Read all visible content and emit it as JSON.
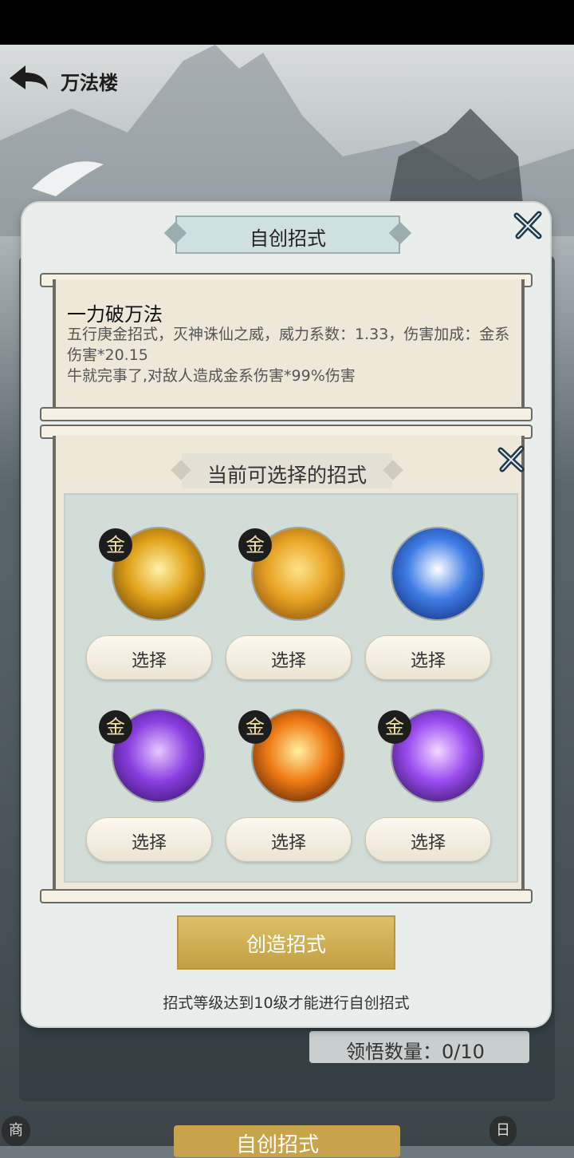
{
  "header": {
    "title": "万法楼"
  },
  "dialog": {
    "title": "自创招式",
    "current_skill": {
      "name": "一力破万法",
      "description": "五行庚金招式，灭神诛仙之威，威力系数：1.33，伤害加成：金系伤害*20.15\n牛就完事了,对敌人造成金系伤害*99%伤害"
    },
    "selection_title": "当前可选择的招式",
    "skills": [
      {
        "badge": "金",
        "select_label": "选择",
        "colors": [
          "#fff3a8",
          "#e0a21a",
          "#5a3104"
        ]
      },
      {
        "badge": "金",
        "select_label": "选择",
        "colors": [
          "#ffe38a",
          "#e8a425",
          "#7a3e08"
        ]
      },
      {
        "badge": "",
        "select_label": "选择",
        "colors": [
          "#ffffff",
          "#3f7de6",
          "#0a1d66"
        ]
      },
      {
        "badge": "金",
        "select_label": "选择",
        "colors": [
          "#e7c8ff",
          "#8a3fe0",
          "#2a0a5a"
        ]
      },
      {
        "badge": "金",
        "select_label": "选择",
        "colors": [
          "#fff0a0",
          "#ef7a14",
          "#3a1205"
        ]
      },
      {
        "badge": "金",
        "select_label": "选择",
        "colors": [
          "#f3d8ff",
          "#9b4cf0",
          "#1f0846"
        ]
      }
    ],
    "create_button": "创造招式",
    "hint": "招式等级达到10级才能进行自创招式"
  },
  "background": {
    "insight_count": "领悟数量：0/10",
    "bottom_button": "自创招式",
    "left_icon": "商",
    "right_icon": "日"
  }
}
